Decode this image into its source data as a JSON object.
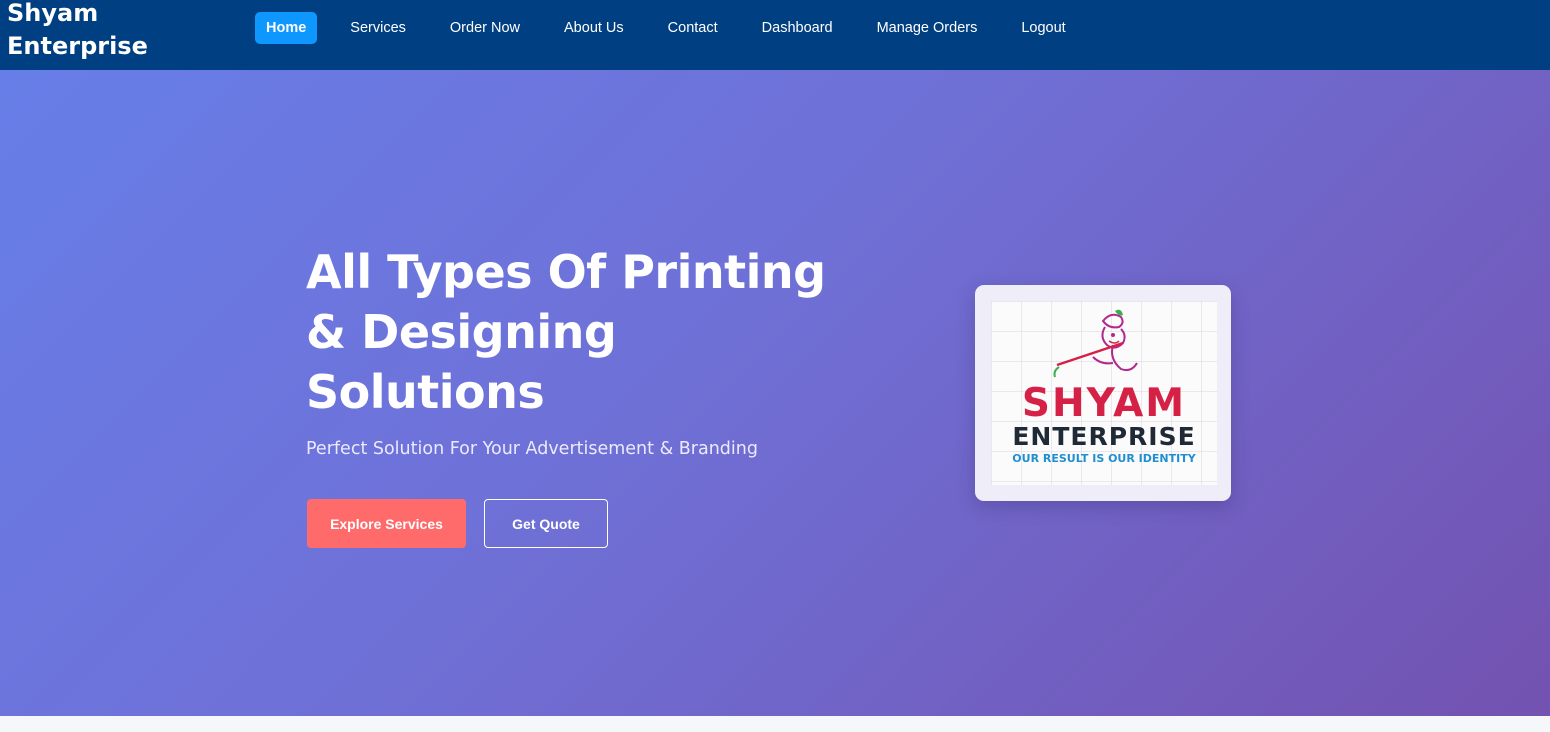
{
  "brand": {
    "name": "Shyam Enterprise"
  },
  "nav": {
    "items": [
      {
        "label": "Home",
        "active": true
      },
      {
        "label": "Services"
      },
      {
        "label": "Order Now"
      },
      {
        "label": "About Us"
      },
      {
        "label": "Contact"
      },
      {
        "label": "Dashboard"
      },
      {
        "label": "Manage Orders"
      },
      {
        "label": "Logout"
      }
    ]
  },
  "hero": {
    "title": "All Types Of Printing & Designing Solutions",
    "subtitle": "Perfect Solution For Your Advertisement & Branding",
    "primary_button": "Explore Services",
    "secondary_button": "Get Quote",
    "logo": {
      "line1": "SHYAM",
      "line2": "ENTERPRISE",
      "tagline": "OUR RESULT IS OUR IDENTITY"
    }
  },
  "colors": {
    "navbar": "#003f82",
    "active_nav": "#0d97ff",
    "primary_button": "#ff6b6b",
    "hero_gradient_start": "#677ee8",
    "hero_gradient_end": "#7352b0",
    "logo_red": "#d62146",
    "logo_blue": "#1f8fd1"
  }
}
